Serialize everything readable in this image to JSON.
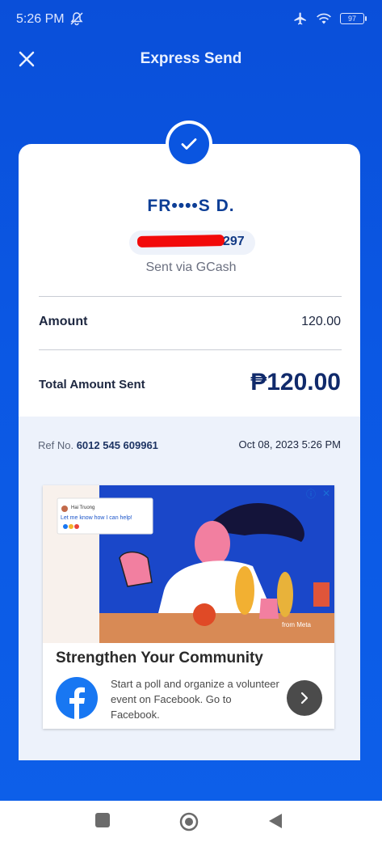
{
  "status_bar": {
    "time": "5:26 PM",
    "battery": "97"
  },
  "header": {
    "title": "Express Send"
  },
  "receipt": {
    "recipient_name": "FR••••S D.",
    "account_suffix": "297",
    "sent_via": "Sent via GCash",
    "amount_label": "Amount",
    "amount_value": "120.00",
    "total_label": "Total Amount Sent",
    "total_value": "₱120.00",
    "ref_label": "Ref No.",
    "ref_number": "6012 545 609961",
    "date": "Oct 08, 2023 5:26 PM"
  },
  "ad": {
    "headline": "Strengthen Your Community",
    "body": "Start a poll and organize a volunteer event on Facebook. Go to Facebook.",
    "brand_tag": "from Meta",
    "chat_name": "Hai Truong",
    "chat_text": "Let me know how I can help!"
  },
  "colors": {
    "brand_blue": "#0a55e0",
    "redaction": "#f20a0a",
    "text_dark": "#102a6b"
  },
  "icons": [
    "close-icon",
    "check-icon",
    "airplane-icon",
    "wifi-icon",
    "battery-icon",
    "mute-icon",
    "info-icon",
    "ad-close-icon",
    "facebook-icon",
    "chevron-right-icon",
    "square-nav-icon",
    "home-circle-icon",
    "back-triangle-icon"
  ]
}
